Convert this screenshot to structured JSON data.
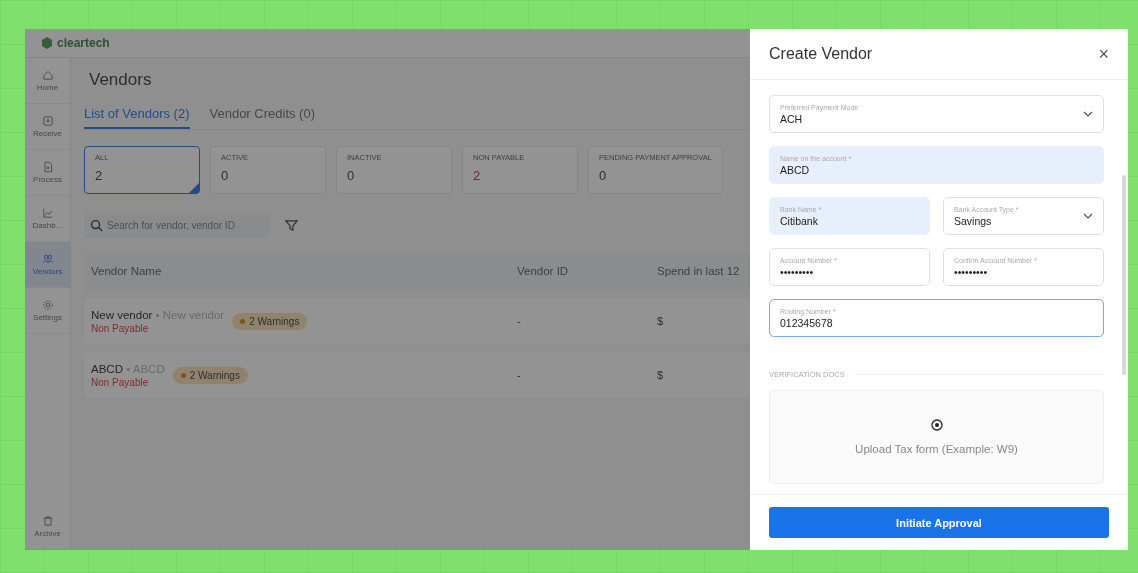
{
  "brand": "cleartech",
  "sidebar": {
    "items": [
      {
        "label": "Home",
        "selected": false
      },
      {
        "label": "Receive",
        "selected": false
      },
      {
        "label": "Process",
        "selected": false
      },
      {
        "label": "Dashb...",
        "selected": false
      },
      {
        "label": "Vendors",
        "selected": true
      },
      {
        "label": "Settings",
        "selected": false
      }
    ],
    "bottom": {
      "label": "Archive"
    }
  },
  "page_title": "Vendors",
  "tabs": [
    {
      "label": "List of Vendors (2)",
      "selected": true
    },
    {
      "label": "Vendor Credits (0)",
      "selected": false
    }
  ],
  "stat_cards": [
    {
      "label": "ALL",
      "value": "2",
      "selected": true,
      "alert": false
    },
    {
      "label": "ACTIVE",
      "value": "0",
      "selected": false,
      "alert": false
    },
    {
      "label": "INACTIVE",
      "value": "0",
      "selected": false,
      "alert": false
    },
    {
      "label": "NON PAYABLE",
      "value": "2",
      "selected": false,
      "alert": true
    },
    {
      "label": "PENDING PAYMENT APPROVAL",
      "value": "0",
      "selected": false,
      "alert": false
    }
  ],
  "search": {
    "placeholder": "Search for vendor, vendor ID"
  },
  "table": {
    "columns": [
      "Vendor Name",
      "Vendor ID",
      "Spend in last 12"
    ],
    "rows": [
      {
        "name": "New vendor",
        "separator": "•",
        "alias": "New vendor",
        "status": "Non Payable",
        "badge": "2 Warnings",
        "vendor_id": "-",
        "spend": "$"
      },
      {
        "name": "ABCD",
        "separator": "•",
        "alias": "ABCD",
        "status": "Non Payable",
        "badge": "2 Warnings",
        "vendor_id": "-",
        "spend": "$"
      }
    ]
  },
  "drawer": {
    "title": "Create Vendor",
    "close": "×",
    "rows": [
      [
        {
          "kind": "select",
          "label": "Preferred Payment Mode",
          "value": "ACH",
          "highlighted": false,
          "focused": false
        }
      ],
      [
        {
          "kind": "input",
          "label": "Name on the account *",
          "value": "ABCD",
          "highlighted": true,
          "focused": false
        }
      ],
      [
        {
          "kind": "input",
          "label": "Bank Name *",
          "value": "Citibank",
          "highlighted": true,
          "focused": false
        },
        {
          "kind": "select",
          "label": "Bank Account Type *",
          "value": "Savings",
          "highlighted": false,
          "focused": false
        }
      ],
      [
        {
          "kind": "input",
          "label": "Account Number *",
          "value": "•••••••••",
          "highlighted": false,
          "focused": false
        },
        {
          "kind": "input",
          "label": "Confirm Account Number *",
          "value": "•••••••••",
          "highlighted": false,
          "focused": false
        }
      ],
      [
        {
          "kind": "input",
          "label": "Routing Number *",
          "value": "012345678",
          "highlighted": false,
          "focused": true
        }
      ]
    ],
    "section": "VERIFICATION DOCS",
    "upload": "Upload Tax form (Example: W9)",
    "button": "Initiate Approval"
  }
}
